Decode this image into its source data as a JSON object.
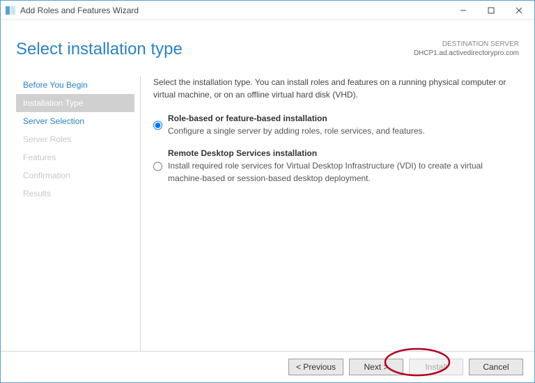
{
  "window": {
    "title": "Add Roles and Features Wizard",
    "controls": {
      "min": "—",
      "max": "☐",
      "close": "✕"
    }
  },
  "header": {
    "title": "Select installation type",
    "destination_label": "DESTINATION SERVER",
    "destination_value": "DHCP1.ad.activedirectorypro.com"
  },
  "sidebar": {
    "items": [
      {
        "label": "Before You Begin",
        "state": "enabled"
      },
      {
        "label": "Installation Type",
        "state": "selected"
      },
      {
        "label": "Server Selection",
        "state": "enabled"
      },
      {
        "label": "Server Roles",
        "state": "disabled"
      },
      {
        "label": "Features",
        "state": "disabled"
      },
      {
        "label": "Confirmation",
        "state": "disabled"
      },
      {
        "label": "Results",
        "state": "disabled"
      }
    ]
  },
  "main": {
    "intro": "Select the installation type. You can install roles and features on a running physical computer or virtual machine, or on an offline virtual hard disk (VHD).",
    "options": [
      {
        "title": "Role-based or feature-based installation",
        "desc": "Configure a single server by adding roles, role services, and features.",
        "selected": true
      },
      {
        "title": "Remote Desktop Services installation",
        "desc": "Install required role services for Virtual Desktop Infrastructure (VDI) to create a virtual machine-based or session-based desktop deployment.",
        "selected": false
      }
    ]
  },
  "footer": {
    "previous": "< Previous",
    "next": "Next >",
    "install": "Install",
    "cancel": "Cancel"
  },
  "annotation": {
    "highlight_target": "next-button",
    "color": "#b00020"
  }
}
